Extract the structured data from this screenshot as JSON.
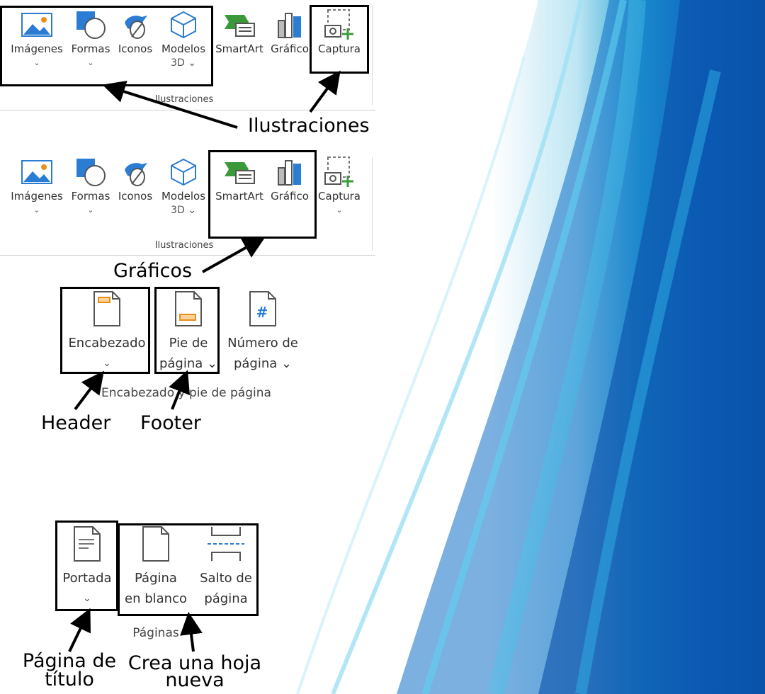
{
  "colors": {
    "accent_green": "#3a9a3a",
    "accent_blue": "#2b7cd3",
    "accent_orange": "#e8901c",
    "outline": "#000000"
  },
  "ribbon_illustrations_1": {
    "buttons": [
      {
        "label": "Imágenes",
        "sub": "⌄",
        "icon": "picture-icon"
      },
      {
        "label": "Formas",
        "sub": "⌄",
        "icon": "shapes-icon"
      },
      {
        "label": "Iconos",
        "sub": "",
        "icon": "bird-leaf-icon"
      },
      {
        "label": "Modelos",
        "sub": "3D ⌄",
        "icon": "cube-icon"
      },
      {
        "label": "SmartArt",
        "sub": "",
        "icon": "smartart-icon"
      },
      {
        "label": "Gráfico",
        "sub": "",
        "icon": "chart-icon"
      },
      {
        "label": "Captura",
        "sub": "",
        "icon": "screenshot-icon"
      }
    ],
    "group_label": "Ilustraciones"
  },
  "ribbon_illustrations_2": {
    "buttons": [
      {
        "label": "Imágenes",
        "sub": "⌄",
        "icon": "picture-icon"
      },
      {
        "label": "Formas",
        "sub": "⌄",
        "icon": "shapes-icon"
      },
      {
        "label": "Iconos",
        "sub": "",
        "icon": "bird-leaf-icon"
      },
      {
        "label": "Modelos",
        "sub": "3D ⌄",
        "icon": "cube-icon"
      },
      {
        "label": "SmartArt",
        "sub": "",
        "icon": "smartart-icon"
      },
      {
        "label": "Gráfico",
        "sub": "",
        "icon": "chart-icon"
      },
      {
        "label": "Captura",
        "sub": "⌄",
        "icon": "screenshot-icon"
      }
    ],
    "group_label": "Ilustraciones"
  },
  "ribbon_header_footer": {
    "buttons": [
      {
        "label": "Encabezado",
        "sub": "⌄",
        "icon": "header-page-icon"
      },
      {
        "label": "Pie de",
        "sub": "página ⌄",
        "icon": "footer-page-icon"
      },
      {
        "label": "Número de",
        "sub": "página ⌄",
        "icon": "page-number-icon"
      }
    ],
    "group_label": "Encabezado y pie de página"
  },
  "ribbon_pages": {
    "buttons": [
      {
        "label": "Portada",
        "sub": "⌄",
        "icon": "cover-page-icon"
      },
      {
        "label": "Página",
        "sub": "en blanco",
        "icon": "blank-page-icon"
      },
      {
        "label": "Salto de",
        "sub": "página",
        "icon": "page-break-icon"
      }
    ],
    "group_label": "Páginas"
  },
  "annotations": {
    "ilustraciones": "Ilustraciones",
    "graficos": "Gráficos",
    "header": "Header",
    "footer": "Footer",
    "pagina_titulo_1": "Página de",
    "pagina_titulo_2": "título",
    "crea_hoja_1": "Crea una hoja",
    "crea_hoja_2": "nueva"
  }
}
